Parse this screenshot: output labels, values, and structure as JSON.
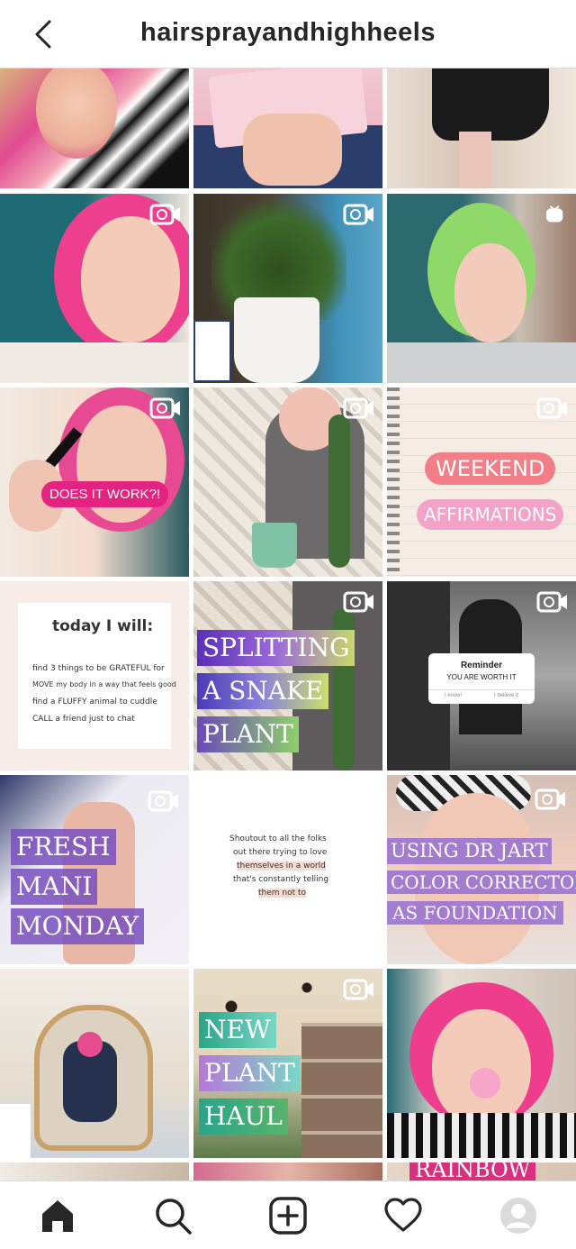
{
  "header": {
    "username": "hairsprayandhighheels"
  },
  "posts": {
    "does_it_work": "DOES IT WORK?!",
    "weekend": "WEEKEND",
    "affirmations": "AFFIRMATIONS",
    "today_title": "today I will:",
    "today_lines": [
      "find 3 things to be GRATEFUL for",
      "MOVE my body in a way that feels good",
      "find a FLUFFY animal to cuddle",
      "CALL a friend just to chat"
    ],
    "splitting": [
      "SPLITTING",
      "A SNAKE",
      "PLANT"
    ],
    "reminder_title": "Reminder",
    "reminder_text": "YOU ARE WORTH IT",
    "reminder_btn1": "I know!",
    "reminder_btn2": "I believe it",
    "fresh": [
      "FRESH",
      "MANI",
      "MONDAY"
    ],
    "shoutout": [
      "Shoutout to all the folks",
      "out there trying to love",
      "themselves in a world",
      "that's constantly telling",
      "them not to"
    ],
    "jart": [
      "USING DR JART",
      "COLOR CORRECTOR",
      "AS FOUNDATION"
    ],
    "haul": [
      "NEW",
      "PLANT",
      "HAUL"
    ],
    "rainbow": "RAINBOW"
  },
  "nav": {
    "icons": [
      "home-icon",
      "search-icon",
      "new-post-icon",
      "activity-heart-icon",
      "profile-avatar"
    ]
  },
  "colors": {
    "accent_pink": "#e8227a",
    "border": "#dbdbdb",
    "text": "#262626"
  }
}
